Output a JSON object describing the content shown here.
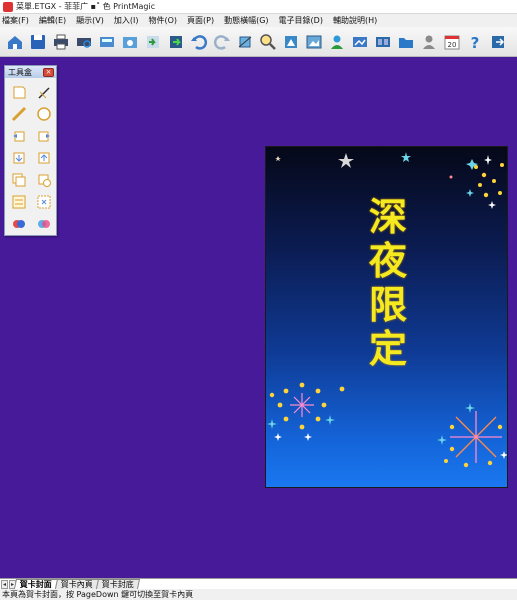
{
  "window": {
    "title": "菜單.ETGX - 菲菲广 ▪˚ 色 PrintMagic"
  },
  "menu": [
    "檔案(F)",
    "編輯(E)",
    "顯示(V)",
    "加入(I)",
    "物件(O)",
    "頁面(P)",
    "動態橫幅(G)",
    "電子目錄(D)",
    "輔助說明(H)"
  ],
  "toolbar_icons": [
    "home-icon",
    "save-icon",
    "print-icon",
    "print-preview-icon",
    "scanner-icon",
    "photo-icon",
    "import-image-icon",
    "export-image-icon",
    "undo-icon",
    "redo-icon",
    "crop-icon",
    "zoom-icon",
    "clipart-icon",
    "picture-frame-icon",
    "user-icon",
    "slideshow-icon",
    "gallery-icon",
    "folder-icon",
    "contact-icon",
    "calendar-icon",
    "help-icon",
    "exit-icon"
  ],
  "calendar_day": "20",
  "toolbox": {
    "title": "工具盒",
    "tools": [
      "text-frame-icon",
      "pen-shape-icon",
      "line-icon",
      "ellipse-icon",
      "rotate-left-icon",
      "rotate-right-icon",
      "move-forward-icon",
      "move-backward-icon",
      "copy-icon",
      "paste-icon",
      "align-icon",
      "group-icon",
      "color-fill-icon",
      "color-mix-icon"
    ]
  },
  "card": {
    "title_chars": [
      "深",
      "夜",
      "限",
      "定"
    ]
  },
  "tabs": [
    "賀卡封面",
    "賀卡內頁",
    "賀卡封底"
  ],
  "status_text": "本頁為賀卡封面，按 PageDown 鍵可切換至賀卡內頁",
  "colors": {
    "workspace": "#471a9a",
    "card_title": "#f5ea1f",
    "card_top": "#060818",
    "card_bottom": "#1a78f0"
  }
}
